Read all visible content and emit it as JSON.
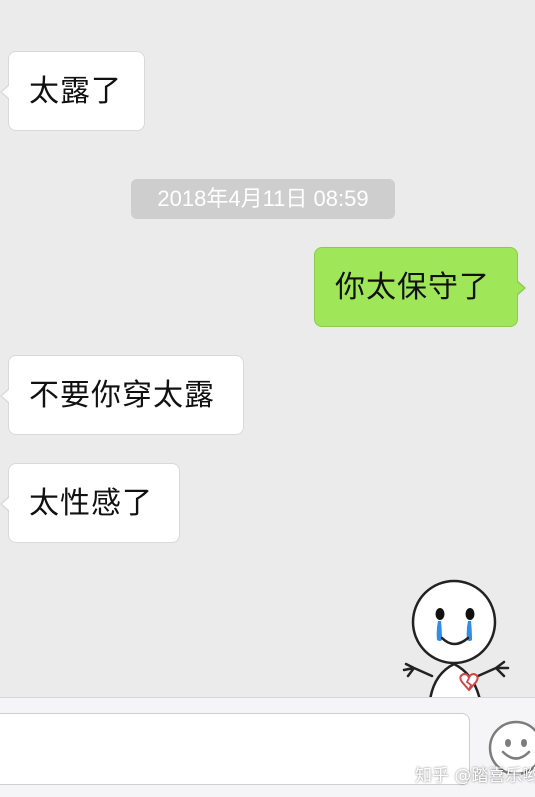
{
  "chat": {
    "messages": [
      {
        "side": "in",
        "text": "太露了"
      },
      {
        "side": "out",
        "text": "你太保守了"
      },
      {
        "side": "in",
        "text": "不要你穿太露"
      },
      {
        "side": "in",
        "text": "太性感了"
      }
    ],
    "timestamp": "2018年4月11日 08:59",
    "sticker_icon": "crying-stick-figure-sticker"
  },
  "input_bar": {
    "emoji_icon": "smiley-face-icon"
  },
  "watermark": "知乎 @踏喜乐哟",
  "colors": {
    "background": "#ebebeb",
    "incoming_bubble": "#ffffff",
    "outgoing_bubble": "#9fe658",
    "timestamp_bg": "#cecece"
  }
}
